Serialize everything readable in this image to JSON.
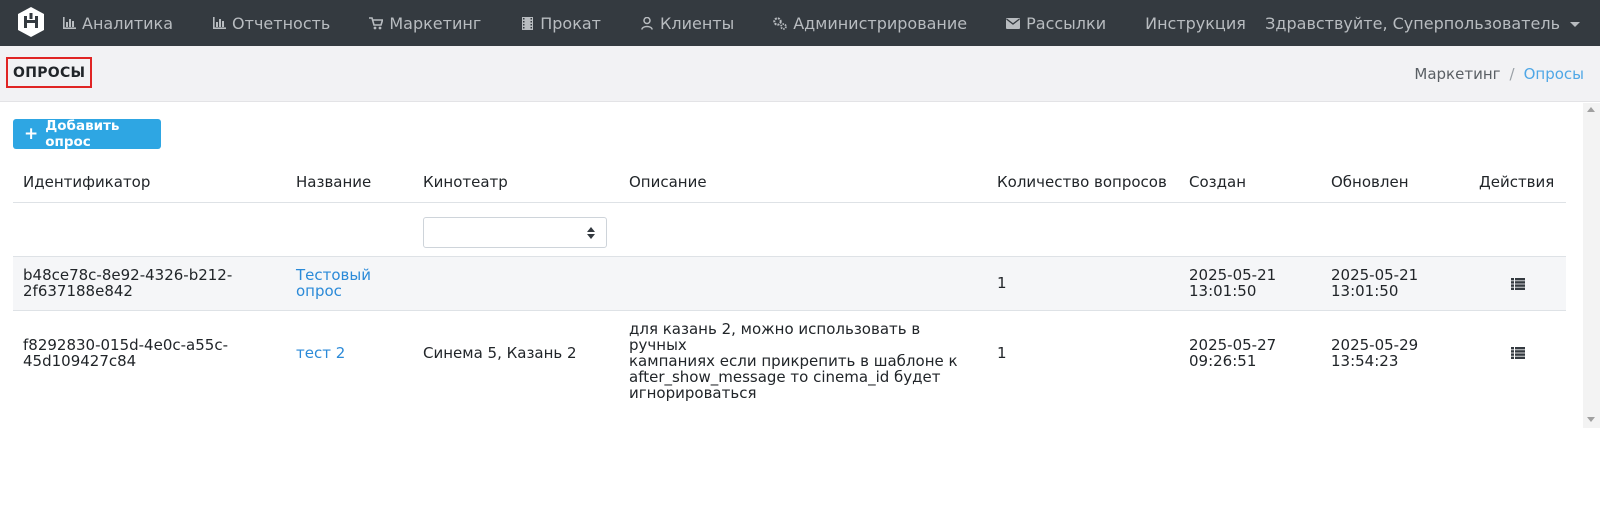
{
  "nav": {
    "items": [
      {
        "label": "Аналитика",
        "icon": "bar-chart-icon"
      },
      {
        "label": "Отчетность",
        "icon": "bar-chart-icon"
      },
      {
        "label": "Маркетинг",
        "icon": "cart-icon"
      },
      {
        "label": "Прокат",
        "icon": "film-icon"
      },
      {
        "label": "Клиенты",
        "icon": "user-icon"
      },
      {
        "label": "Администрирование",
        "icon": "gears-icon"
      },
      {
        "label": "Рассылки",
        "icon": "envelope-icon"
      },
      {
        "label": "Инструкция",
        "icon": ""
      }
    ],
    "user_greeting": "Здравствуйте, Суперпользователь"
  },
  "page": {
    "title": "ОПРОСЫ",
    "breadcrumb": {
      "parent": "Маркетинг",
      "separator": "/",
      "current": "Опросы"
    }
  },
  "toolbar": {
    "add_label": "Добавить опрос"
  },
  "table": {
    "headers": [
      "Идентификатор",
      "Название",
      "Кинотеатр",
      "Описание",
      "Количество вопросов",
      "Создан",
      "Обновлен",
      "Действия"
    ],
    "cinema_filter_value": "",
    "rows": [
      {
        "id_line1": "b48ce78c-8e92-4326-b212-",
        "id_line2": "2f637188e842",
        "name_line1": "Тестовый",
        "name_line2": "опрос",
        "cinema": "",
        "description": [
          "",
          "",
          "",
          ""
        ],
        "questions": "1",
        "created_date": "2025-05-21",
        "created_time": "13:01:50",
        "updated_date": "2025-05-21",
        "updated_time": "13:01:50"
      },
      {
        "id_line1": "f8292830-015d-4e0c-a55c-",
        "id_line2": "45d109427c84",
        "name_line1": "тест 2",
        "name_line2": "",
        "cinema": "Синема 5, Казань 2",
        "description": [
          "для казань 2, можно использовать в ручных",
          "кампаниях если прикрепить в шаблоне к",
          "after_show_message то cinema_id будет",
          "игнорироваться"
        ],
        "questions": "1",
        "created_date": "2025-05-27",
        "created_time": "09:26:51",
        "updated_date": "2025-05-29",
        "updated_time": "13:54:23"
      }
    ]
  },
  "colors": {
    "navbar": "#343a40",
    "accent": "#2ea6e3",
    "link": "#2b8ad8",
    "highlight_border": "#e02424"
  }
}
